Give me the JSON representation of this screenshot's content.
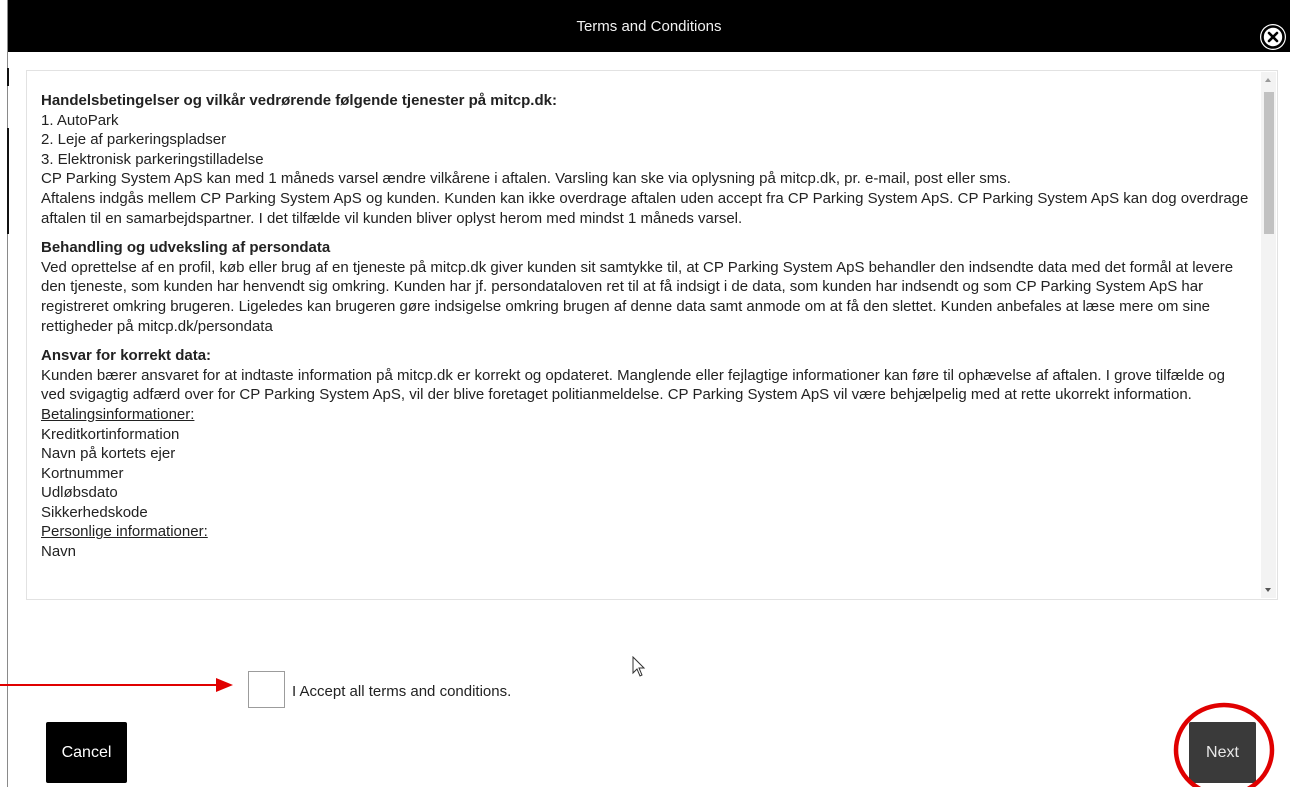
{
  "dialog": {
    "title": "Terms and Conditions",
    "close_icon": "close-circle-icon"
  },
  "terms": {
    "sections": [
      {
        "title": "Handelsbetingelser og vilkår vedrørende følgende tjenester på mitcp.dk:",
        "lines": [
          "1. AutoPark",
          "2. Leje af parkeringspladser",
          "3. Elektronisk parkeringstilladelse",
          "CP Parking System ApS kan med 1 måneds varsel ændre vilkårene i aftalen. Varsling kan ske via oplysning på mitcp.dk, pr. e-mail, post eller sms.",
          "Aftalens indgås mellem CP Parking System ApS og kunden. Kunden kan ikke overdrage aftalen uden accept fra CP Parking System ApS. CP Parking System ApS kan dog overdrage aftalen til en samarbejdspartner. I det tilfælde vil kunden bliver oplyst herom med mindst 1 måneds varsel."
        ]
      },
      {
        "title": "Behandling og udveksling af persondata",
        "lines": [
          "Ved oprettelse af en profil, køb eller brug af en tjeneste på mitcp.dk giver kunden sit samtykke til, at CP Parking System ApS behandler den indsendte data med det formål at levere den tjeneste, som kunden har henvendt sig omkring. Kunden har jf. persondataloven ret til at få indsigt i de data, som kunden har indsendt og som CP Parking System ApS har registreret omkring brugeren. Ligeledes kan brugeren gøre indsigelse omkring brugen af denne data samt anmode om at få den slettet. Kunden anbefales at læse mere om sine rettigheder på mitcp.dk/persondata"
        ]
      },
      {
        "title": "Ansvar for korrekt data:",
        "lines": [
          "Kunden bærer ansvaret for at indtaste information på mitcp.dk er korrekt og opdateret. Manglende eller fejlagtige informationer kan føre til ophævelse af aftalen. I grove tilfælde og ved svigagtig adfærd over for CP Parking System ApS, vil der blive foretaget politianmeldelse. CP Parking System ApS vil være behjælpelig med at rette ukorrekt information."
        ],
        "payment_heading": "Betalingsinformationer:",
        "payment_items": [
          "Kreditkortinformation",
          "Navn på kortets ejer",
          "Kortnummer",
          "Udløbsdato",
          "Sikkerhedskode"
        ],
        "personal_heading": "Personlige informationer:",
        "personal_items": [
          "Navn"
        ]
      }
    ]
  },
  "accept": {
    "label": "I Accept all terms and conditions.",
    "checked": false
  },
  "buttons": {
    "cancel": "Cancel",
    "next": "Next"
  },
  "colors": {
    "header_bg": "#000000",
    "cancel_bg": "#000000",
    "next_bg": "#3a3a3a",
    "annotation": "#e00000"
  }
}
